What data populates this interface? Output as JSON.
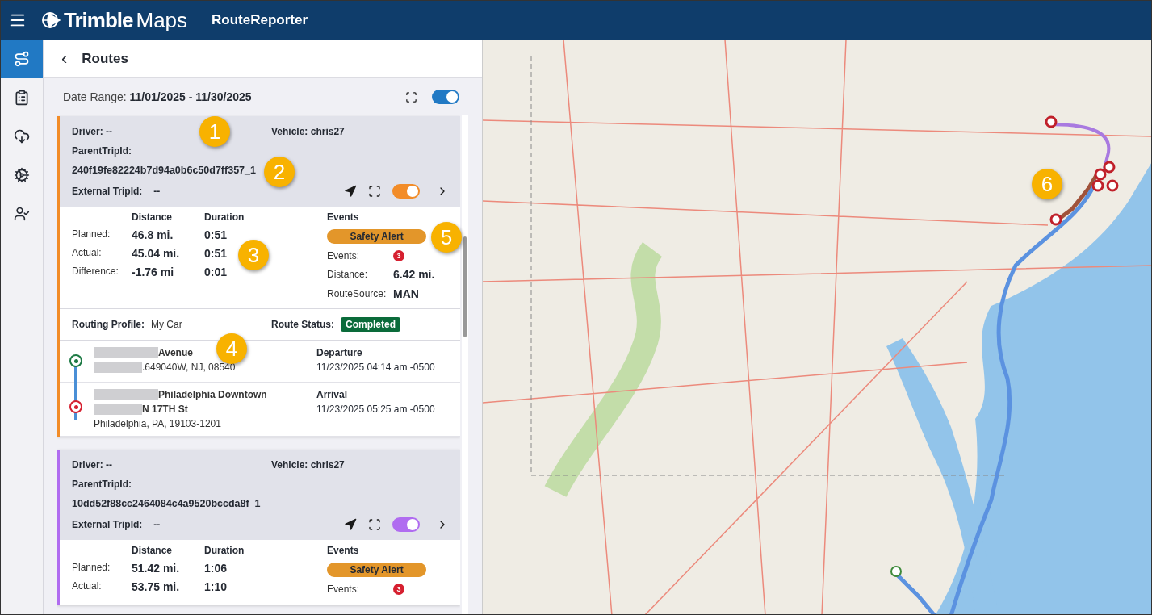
{
  "app": {
    "brand_bold": "Trimble",
    "brand_light": "Maps",
    "product": "RouteReporter"
  },
  "nav_items": [
    {
      "selected": true
    },
    {
      "selected": false
    },
    {
      "selected": false
    },
    {
      "selected": false
    },
    {
      "selected": false
    }
  ],
  "panel": {
    "back": "‹",
    "title": "Routes",
    "date_label": "Date Range:",
    "date_value": "11/01/2025 - 11/30/2025",
    "show_all_on": true
  },
  "routes": [
    {
      "color": "#f28c28",
      "visible": true,
      "driver_label": "Driver:",
      "driver": "--",
      "vehicle_label": "Vehicle:",
      "vehicle": "chris27",
      "parent_label": "ParentTripId:",
      "parent_id": "240f19fe82224b7d94a0b6c50d7ff357_1",
      "external_label": "External TripId:",
      "external_id": "--",
      "col_distance": "Distance",
      "col_duration": "Duration",
      "stats": [
        {
          "label": "Planned:",
          "distance": "46.8 mi.",
          "duration": "0:51"
        },
        {
          "label": "Actual:",
          "distance": "45.04 mi.",
          "duration": "0:51"
        },
        {
          "label": "Difference:",
          "distance": "-1.76 mi",
          "duration": "0:01"
        }
      ],
      "events_title": "Events",
      "alert": "Safety Alert",
      "events_label": "Events:",
      "events_count": "3",
      "event_distance_label": "Distance:",
      "event_distance": "6.42 mi.",
      "source_label": "RouteSource:",
      "source": "MAN",
      "profile_label": "Routing Profile:",
      "profile": "My Car",
      "status_label": "Route Status:",
      "status": "Completed",
      "stops": [
        {
          "kind": "origin",
          "lines": [
            {
              "redacted": true,
              "bold": true,
              "text": "Avenue"
            },
            {
              "redacted": true,
              "bold": false,
              "text": ".649040W, NJ, 08540"
            }
          ],
          "time_label": "Departure",
          "time": "11/23/2025 04:14 am -0500"
        },
        {
          "kind": "destination",
          "lines": [
            {
              "redacted": true,
              "bold": true,
              "text": "Philadelphia Downtown"
            },
            {
              "redacted": true,
              "bold": true,
              "text": "N 17TH St"
            },
            {
              "redacted": false,
              "bold": false,
              "text": "Philadelphia, PA, 19103-1201"
            }
          ],
          "time_label": "Arrival",
          "time": "11/23/2025 05:25 am -0500"
        }
      ]
    },
    {
      "color": "#b06cf0",
      "visible": true,
      "driver_label": "Driver:",
      "driver": "--",
      "vehicle_label": "Vehicle:",
      "vehicle": "chris27",
      "parent_label": "ParentTripId:",
      "parent_id": "10dd52f88cc2464084c4a9520bccda8f_1",
      "external_label": "External TripId:",
      "external_id": "--",
      "col_distance": "Distance",
      "col_duration": "Duration",
      "stats": [
        {
          "label": "Planned:",
          "distance": "51.42 mi.",
          "duration": "1:06"
        },
        {
          "label": "Actual:",
          "distance": "53.75 mi.",
          "duration": "1:10"
        }
      ],
      "events_title": "Events",
      "alert": "Safety Alert",
      "events_label": "Events:",
      "events_count": "3"
    }
  ],
  "callouts": [
    "1",
    "2",
    "3",
    "4",
    "5",
    "6"
  ]
}
